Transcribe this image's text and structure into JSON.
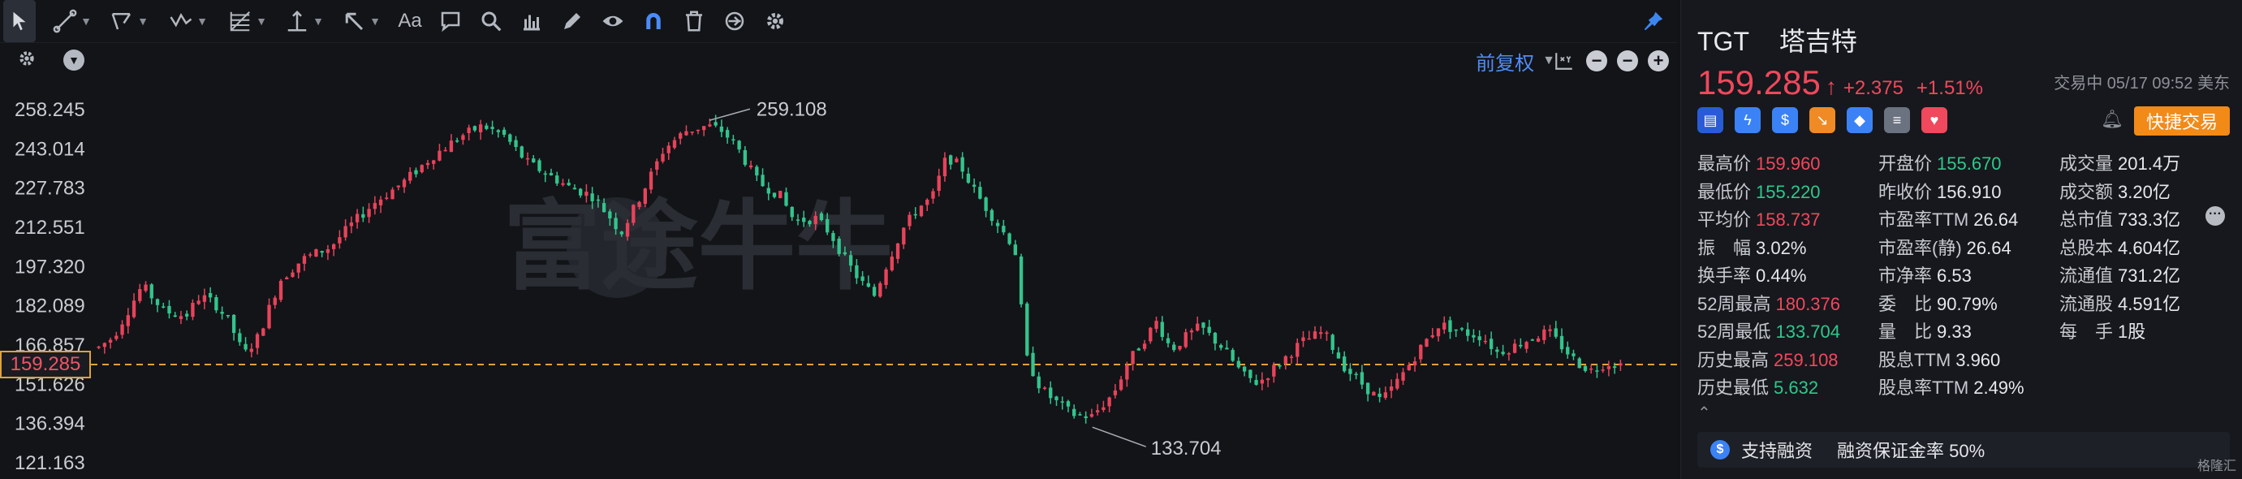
{
  "toolbar": {
    "items": [
      {
        "name": "cursor-tool",
        "icon": "cursor-icon"
      },
      {
        "name": "line-tool",
        "icon": "trend-line-icon"
      },
      {
        "name": "channel-tool",
        "icon": "parallel-channel-icon"
      },
      {
        "name": "wave-tool",
        "icon": "wave-icon"
      },
      {
        "name": "fib-tool",
        "icon": "fibonacci-icon"
      },
      {
        "name": "horizontal-line-tool",
        "icon": "horizontal-line-icon"
      },
      {
        "name": "arrow-tool",
        "icon": "arrow-icon"
      },
      {
        "name": "text-tool",
        "label": "Aa"
      },
      {
        "name": "note-tool",
        "icon": "comment-icon"
      },
      {
        "name": "zoom-tool",
        "icon": "search-icon"
      },
      {
        "name": "measure-tool",
        "icon": "ruler-icon"
      },
      {
        "name": "pencil-tool",
        "icon": "pencil-icon"
      },
      {
        "name": "visibility-tool",
        "icon": "eye-icon"
      },
      {
        "name": "magnet-tool",
        "icon": "magnet-icon"
      },
      {
        "name": "delete-tool",
        "icon": "trash-icon"
      },
      {
        "name": "sync-tool",
        "icon": "sync-icon"
      },
      {
        "name": "settings-tool",
        "icon": "gear-icon"
      }
    ],
    "text_tool_label": "Aa"
  },
  "chart_header": {
    "adjust_mode": "前复权"
  },
  "chart_data": {
    "type": "candlestick",
    "ytick_labels": [
      "258.245",
      "243.014",
      "227.783",
      "212.551",
      "197.320",
      "182.089",
      "166.857",
      "151.626",
      "136.394",
      "121.163"
    ],
    "ylim": [
      121.163,
      258.245
    ],
    "max_annotation": {
      "value": 259.108,
      "label": "259.108"
    },
    "min_annotation": {
      "value": 133.704,
      "label": "133.704"
    },
    "current_price": {
      "value": 159.285,
      "label": "159.285"
    },
    "watermark": "富途牛牛",
    "series_colors": {
      "up": "#e8435a",
      "down": "#33c48c"
    },
    "path": [
      [
        0,
        166
      ],
      [
        0.01,
        170
      ],
      [
        0.03,
        190
      ],
      [
        0.045,
        180
      ],
      [
        0.06,
        178
      ],
      [
        0.07,
        186
      ],
      [
        0.08,
        183
      ],
      [
        0.09,
        176
      ],
      [
        0.1,
        163
      ],
      [
        0.11,
        170
      ],
      [
        0.125,
        192
      ],
      [
        0.14,
        200
      ],
      [
        0.16,
        205
      ],
      [
        0.175,
        214
      ],
      [
        0.19,
        222
      ],
      [
        0.21,
        230
      ],
      [
        0.23,
        240
      ],
      [
        0.25,
        248
      ],
      [
        0.265,
        252
      ],
      [
        0.28,
        248
      ],
      [
        0.295,
        238
      ],
      [
        0.31,
        233
      ],
      [
        0.325,
        228
      ],
      [
        0.34,
        225
      ],
      [
        0.355,
        215
      ],
      [
        0.36,
        210
      ],
      [
        0.375,
        226
      ],
      [
        0.39,
        243
      ],
      [
        0.405,
        250
      ],
      [
        0.42,
        252
      ],
      [
        0.43,
        250
      ],
      [
        0.44,
        244
      ],
      [
        0.455,
        230
      ],
      [
        0.47,
        225
      ],
      [
        0.48,
        215
      ],
      [
        0.495,
        216
      ],
      [
        0.505,
        210
      ],
      [
        0.515,
        200
      ],
      [
        0.525,
        192
      ],
      [
        0.535,
        186
      ],
      [
        0.545,
        200
      ],
      [
        0.555,
        212
      ],
      [
        0.565,
        220
      ],
      [
        0.575,
        224
      ],
      [
        0.585,
        240
      ],
      [
        0.595,
        236
      ],
      [
        0.605,
        226
      ],
      [
        0.615,
        218
      ],
      [
        0.625,
        210
      ],
      [
        0.632,
        205
      ],
      [
        0.64,
        162
      ],
      [
        0.65,
        150
      ],
      [
        0.66,
        145
      ],
      [
        0.672,
        140
      ],
      [
        0.685,
        139
      ],
      [
        0.7,
        148
      ],
      [
        0.71,
        160
      ],
      [
        0.72,
        168
      ],
      [
        0.73,
        176
      ],
      [
        0.74,
        165
      ],
      [
        0.75,
        170
      ],
      [
        0.76,
        174
      ],
      [
        0.775,
        166
      ],
      [
        0.79,
        155
      ],
      [
        0.8,
        152
      ],
      [
        0.815,
        160
      ],
      [
        0.83,
        168
      ],
      [
        0.845,
        172
      ],
      [
        0.86,
        158
      ],
      [
        0.875,
        150
      ],
      [
        0.885,
        145
      ],
      [
        0.895,
        152
      ],
      [
        0.905,
        160
      ],
      [
        0.915,
        168
      ],
      [
        0.925,
        175
      ],
      [
        0.94,
        172
      ],
      [
        0.955,
        170
      ],
      [
        0.965,
        164
      ],
      [
        0.975,
        166
      ],
      [
        0.99,
        170
      ],
      [
        1.0,
        172
      ],
      [
        1.01,
        166
      ],
      [
        1.02,
        160
      ],
      [
        1.03,
        157
      ],
      [
        1.04,
        160
      ],
      [
        1.05,
        159.3
      ]
    ]
  },
  "info": {
    "ticker": "TGT",
    "name": "塔吉特",
    "last_price": "159.285",
    "arrow": "↑",
    "change": "+2.375",
    "change_pct": "+1.51%",
    "trade_status": "交易中 05/17 09:52 美东",
    "quick_trade": "快捷交易",
    "badges": [
      {
        "icon": "us-flag-icon",
        "color": "#2a5bd7",
        "glyph": "▤"
      },
      {
        "icon": "lightning-icon",
        "color": "#3b82f6",
        "glyph": "ϟ"
      },
      {
        "icon": "dollar-icon",
        "color": "#3b82f6",
        "glyph": "$"
      },
      {
        "icon": "trend-down-icon",
        "color": "#f08a24",
        "glyph": "↘"
      },
      {
        "icon": "tag-icon",
        "color": "#3b82f6",
        "glyph": "◆"
      },
      {
        "icon": "document-icon",
        "color": "#6b7280",
        "glyph": "≡"
      },
      {
        "icon": "heart-icon",
        "color": "#f0485c",
        "glyph": "♥"
      }
    ],
    "rows": [
      [
        {
          "label": "最高价",
          "value": "159.960",
          "color": "red"
        },
        {
          "label": "开盘价",
          "value": "155.670",
          "color": "green"
        },
        {
          "label": "成交量",
          "value": "201.4万",
          "color": "white"
        }
      ],
      [
        {
          "label": "最低价",
          "value": "155.220",
          "color": "green"
        },
        {
          "label": "昨收价",
          "value": "156.910",
          "color": "white"
        },
        {
          "label": "成交额",
          "value": "3.20亿",
          "color": "white"
        }
      ],
      [
        {
          "label": "平均价",
          "value": "158.737",
          "color": "red"
        },
        {
          "label": "市盈率TTM",
          "value": "26.64",
          "color": "white"
        },
        {
          "label": "总市值",
          "value": "733.3亿",
          "color": "white"
        }
      ],
      [
        {
          "label": "振　幅",
          "value": "3.02%",
          "color": "white"
        },
        {
          "label": "市盈率(静)",
          "value": "26.64",
          "color": "white"
        },
        {
          "label": "总股本",
          "value": "4.604亿",
          "color": "white"
        }
      ],
      [
        {
          "label": "换手率",
          "value": "0.44%",
          "color": "white"
        },
        {
          "label": "市净率",
          "value": "6.53",
          "color": "white"
        },
        {
          "label": "流通值",
          "value": "731.2亿",
          "color": "white"
        }
      ],
      [
        {
          "label": "52周最高",
          "value": "180.376",
          "color": "red"
        },
        {
          "label": "委　比",
          "value": "90.79%",
          "color": "white"
        },
        {
          "label": "流通股",
          "value": "4.591亿",
          "color": "white"
        }
      ],
      [
        {
          "label": "52周最低",
          "value": "133.704",
          "color": "green"
        },
        {
          "label": "量　比",
          "value": "9.33",
          "color": "white"
        },
        {
          "label": "每　手",
          "value": "1股",
          "color": "white"
        }
      ],
      [
        {
          "label": "历史最高",
          "value": "259.108",
          "color": "red"
        },
        {
          "label": "股息TTM",
          "value": "3.960",
          "color": "white"
        }
      ],
      [
        {
          "label": "历史最低",
          "value": "5.632",
          "color": "green"
        },
        {
          "label": "股息率TTM",
          "value": "2.49%",
          "color": "white"
        }
      ]
    ],
    "margin_text": "支持融资",
    "margin_rate": "融资保证金率 50%",
    "corner_logo": "格隆汇"
  }
}
